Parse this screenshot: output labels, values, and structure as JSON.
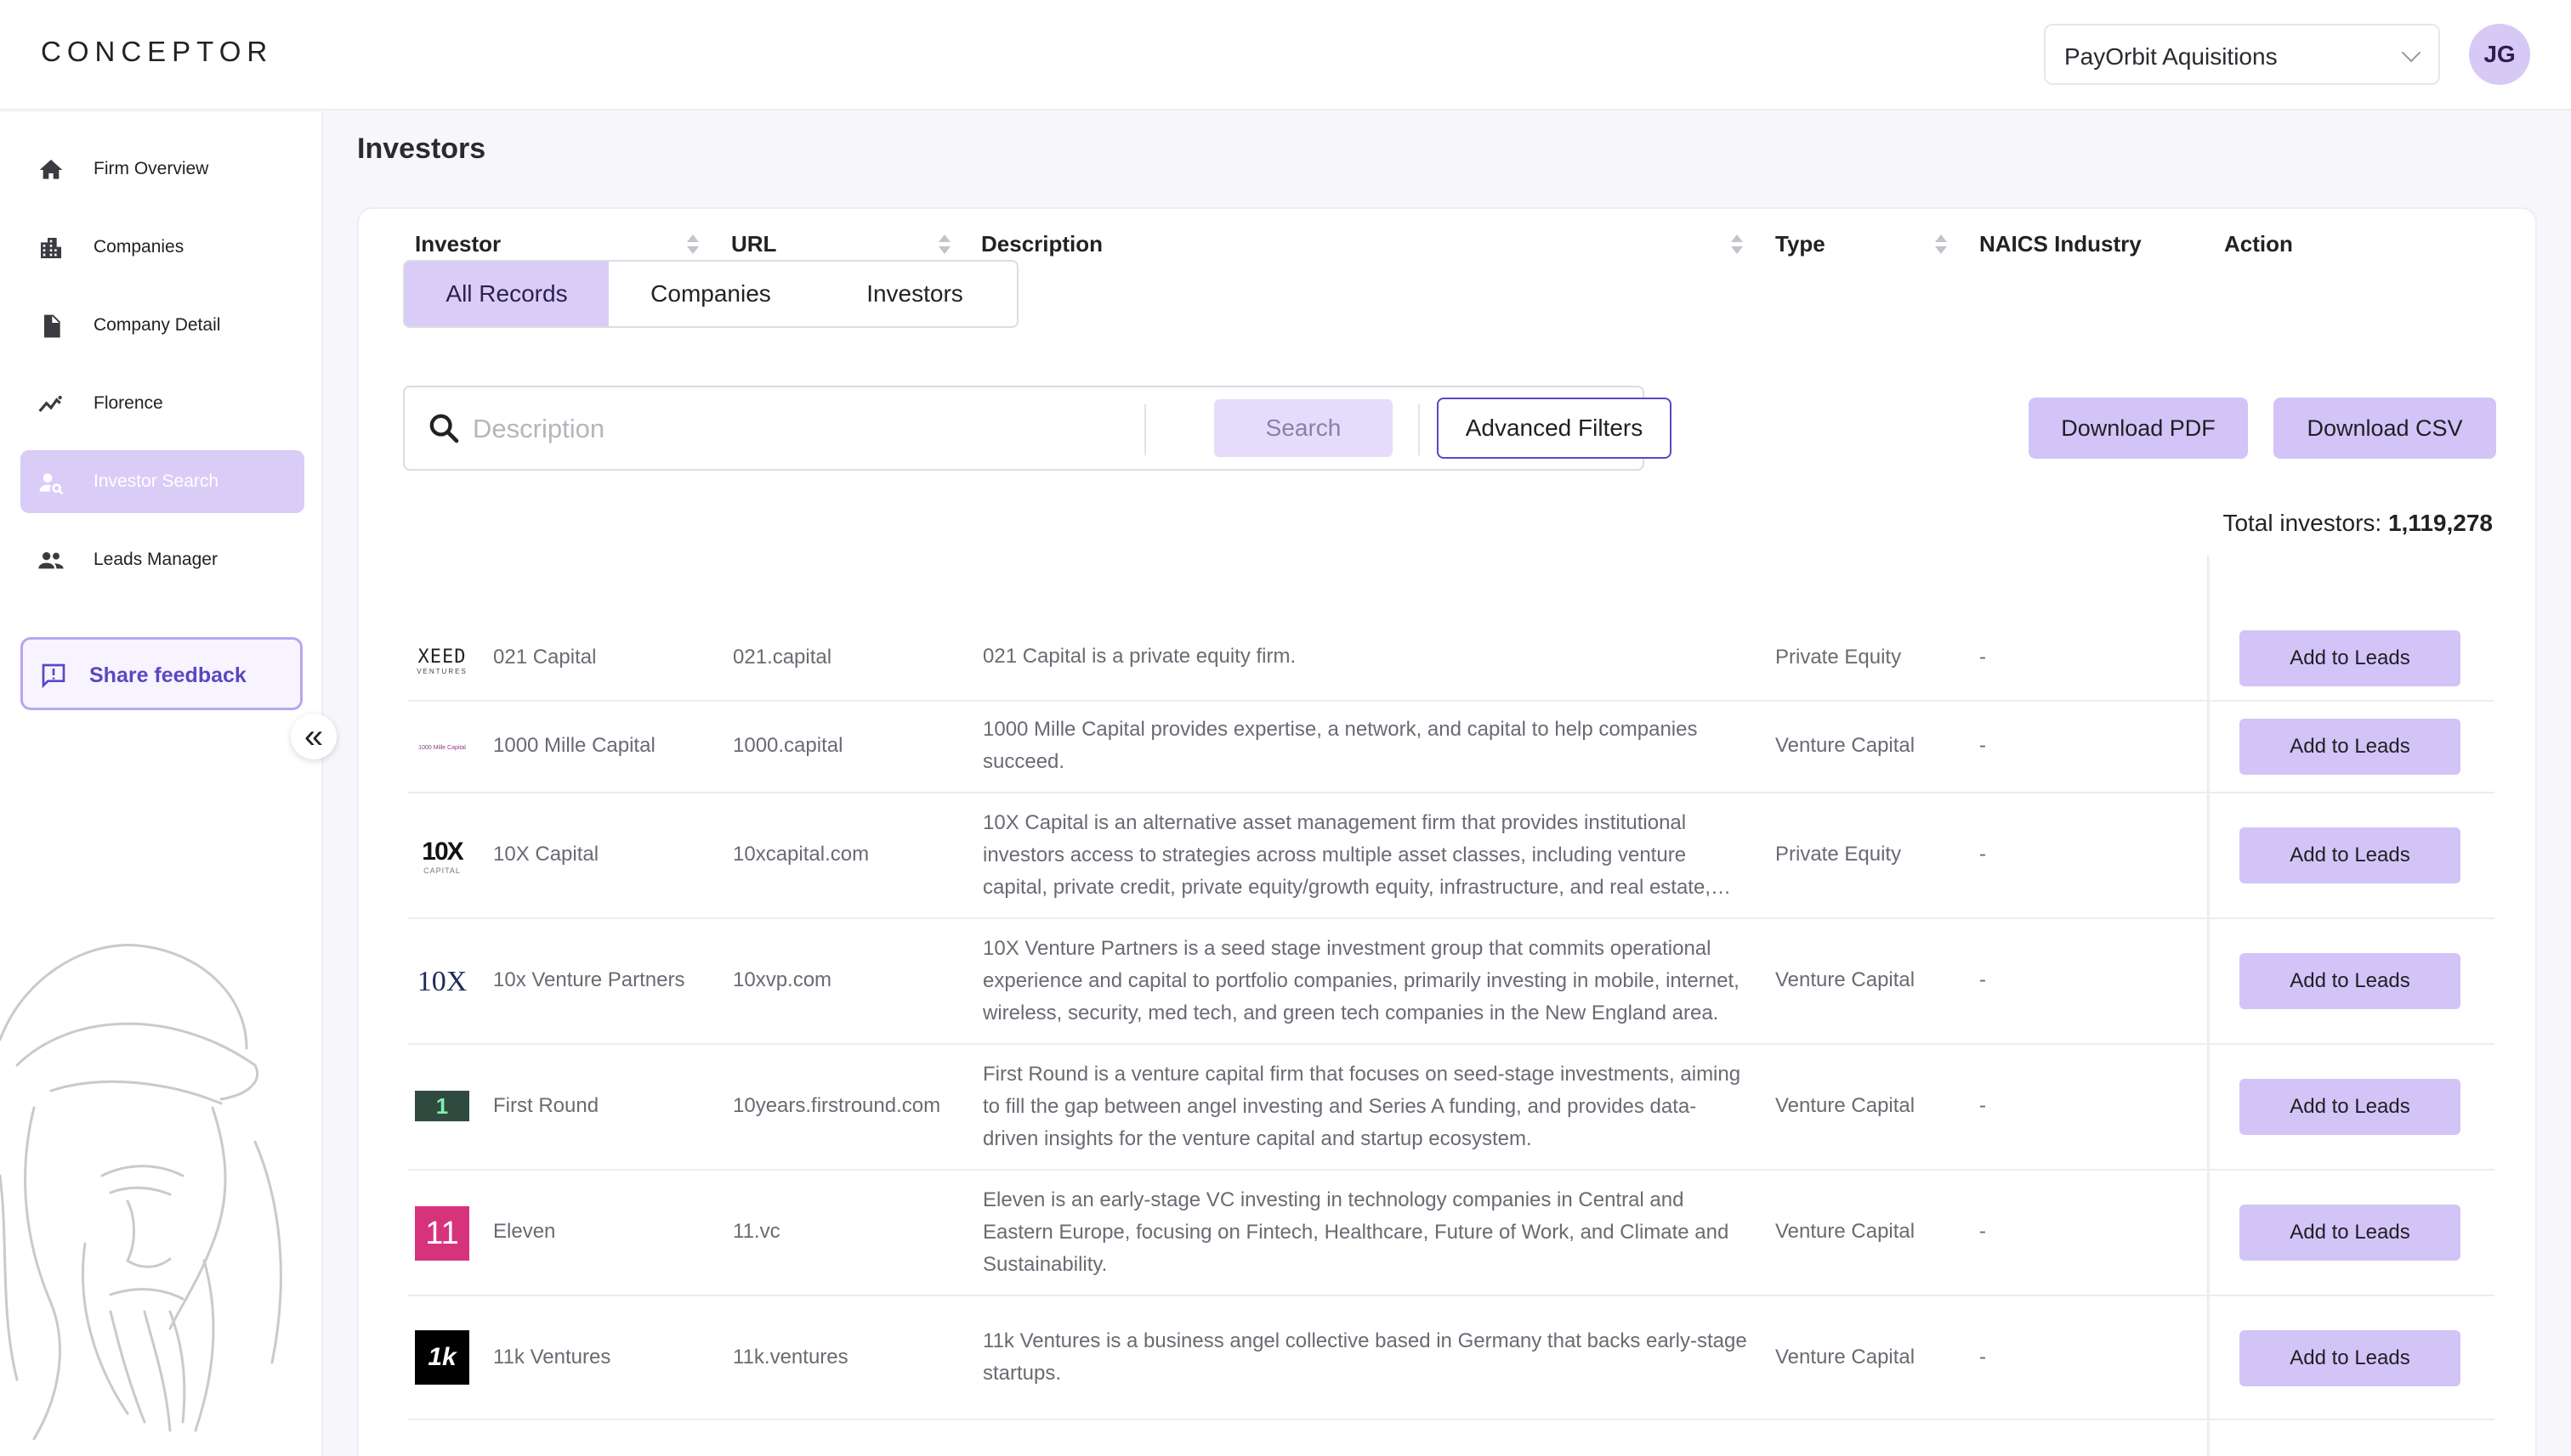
{
  "brand": "CONCEPTOR",
  "header": {
    "firm_select": "PayOrbit Aquisitions",
    "avatar_initials": "JG"
  },
  "sidebar": {
    "items": [
      {
        "label": "Firm Overview",
        "icon": "home-icon"
      },
      {
        "label": "Companies",
        "icon": "building-icon"
      },
      {
        "label": "Company Detail",
        "icon": "document-icon"
      },
      {
        "label": "Florence",
        "icon": "chart-line-icon"
      },
      {
        "label": "Investor Search",
        "icon": "person-search-icon"
      },
      {
        "label": "Leads Manager",
        "icon": "people-icon"
      }
    ],
    "active_index": 4,
    "feedback_label": "Share feedback",
    "collapse_glyph": "«"
  },
  "page": {
    "title": "Investors",
    "tabs": [
      "All Records",
      "Companies",
      "Investors"
    ],
    "active_tab": 0,
    "search": {
      "placeholder": "Description",
      "button": "Search",
      "advanced": "Advanced Filters"
    },
    "download_pdf": "Download PDF",
    "download_csv": "Download CSV",
    "total_label": "Total investors: ",
    "total_value": "1,119,278"
  },
  "table": {
    "columns": [
      "Investor",
      "URL",
      "Description",
      "Type",
      "NAICS Industry",
      "Action"
    ],
    "action_label": "Add to Leads",
    "rows": [
      {
        "logo": "XEED",
        "logo_sub": "VENTURES",
        "investor": "021 Capital",
        "url": "021.capital",
        "description": "021 Capital is a private equity firm.",
        "type": "Private Equity",
        "naics": "-"
      },
      {
        "logo": "1000 Mille Capital",
        "investor": "1000 Mille Capital",
        "url": "1000.capital",
        "description": "1000 Mille Capital provides expertise, a network, and capital to help companies succeed.",
        "type": "Venture Capital",
        "naics": "-"
      },
      {
        "logo": "10X",
        "logo_sub": "CAPITAL",
        "investor": "10X Capital",
        "url": "10xcapital.com",
        "description": "10X Capital is an alternative asset management firm that provides institutional investors access to strategies across multiple asset classes, including venture capital, private credit, private equity/growth equity, infrastructure, and real estate,…",
        "type": "Private Equity",
        "naics": "-"
      },
      {
        "logo": "10X",
        "investor": "10x Venture Partners",
        "url": "10xvp.com",
        "description": "10X Venture Partners is a seed stage investment group that commits operational experience and capital to portfolio companies, primarily investing in mobile, internet, wireless, security, med tech, and green tech companies in the New England area.",
        "type": "Venture Capital",
        "naics": "-"
      },
      {
        "logo": "1",
        "investor": "First Round",
        "url": "10years.firstround.com",
        "description": "First Round is a venture capital firm that focuses on seed-stage investments, aiming to fill the gap between angel investing and Series A funding, and provides data-driven insights for the venture capital and startup ecosystem.",
        "type": "Venture Capital",
        "naics": "-"
      },
      {
        "logo": "11",
        "investor": "Eleven",
        "url": "11.vc",
        "description": "Eleven is an early-stage VC investing in technology companies in Central and Eastern Europe, focusing on Fintech, Healthcare, Future of Work, and Climate and Sustainability.",
        "type": "Venture Capital",
        "naics": "-"
      },
      {
        "logo": "1k",
        "investor": "11k Ventures",
        "url": "11k.ventures",
        "description": "11k Ventures is a business angel collective based in Germany that backs early-stage startups.",
        "type": "Venture Capital",
        "naics": "-"
      }
    ]
  },
  "colors": {
    "accent": "#d2c4f7",
    "accent_dark": "#5b47c2",
    "eleven_logo": "#d6337c",
    "first_round_logo": "#2f4a3e"
  }
}
